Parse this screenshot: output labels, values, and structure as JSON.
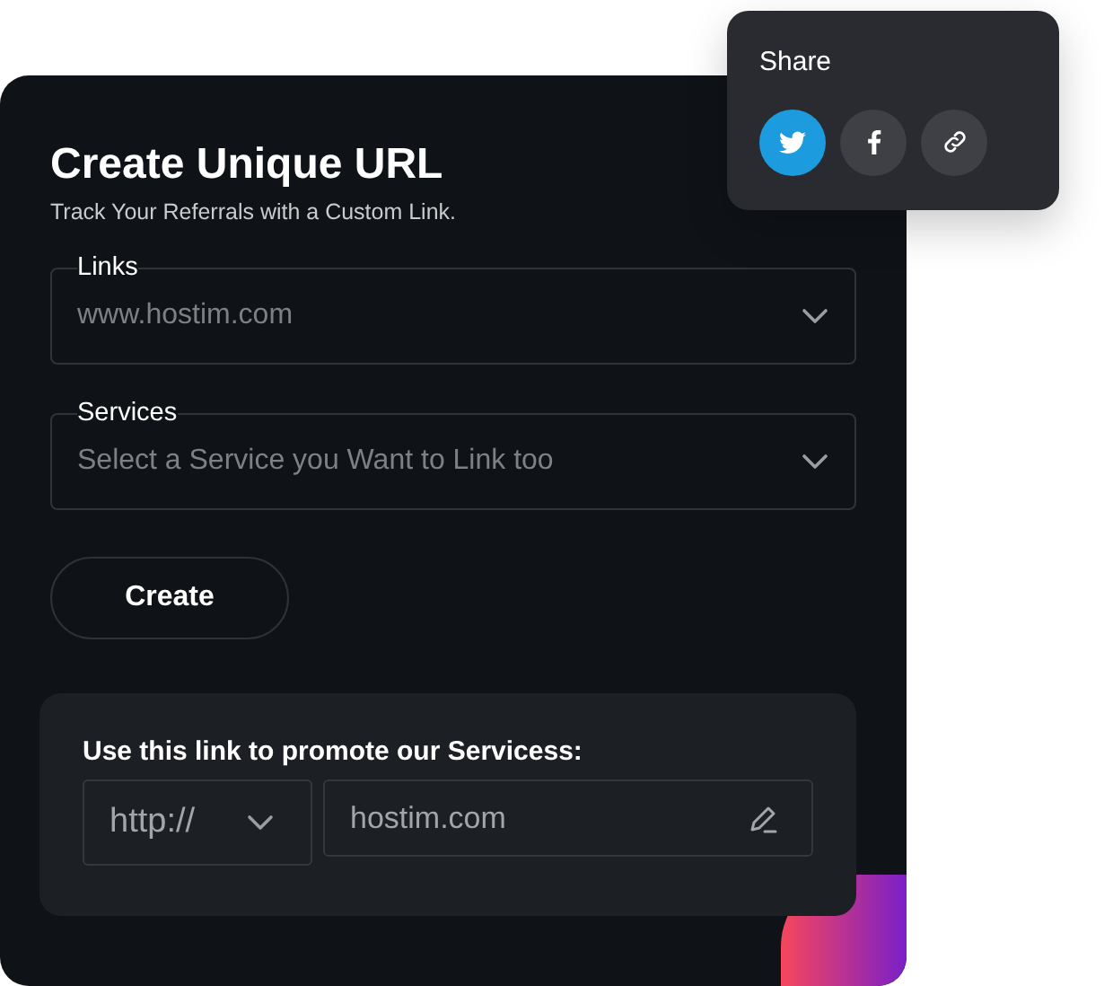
{
  "card": {
    "title": "Create Unique URL",
    "subtitle": "Track Your Referrals with a Custom Link.",
    "fields": [
      {
        "label": "Links",
        "placeholder": "www.hostim.com"
      },
      {
        "label": "Services",
        "placeholder": "Select a Service you Want to Link too"
      }
    ],
    "create_button": "Create",
    "promote": {
      "label": "Use this link to promote our Servicess:",
      "protocol": "http://",
      "domain": "hostim.com"
    }
  },
  "share": {
    "title": "Share",
    "buttons": [
      {
        "kind": "twitter",
        "color": "#1d9bdf"
      },
      {
        "kind": "facebook",
        "color": "#3f4045"
      },
      {
        "kind": "link",
        "color": "#3f4045"
      }
    ]
  }
}
